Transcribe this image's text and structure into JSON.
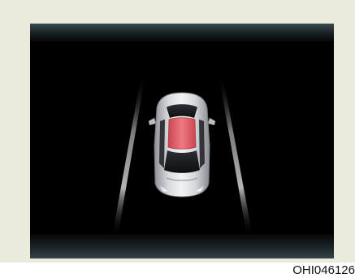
{
  "figure": {
    "caption": "OHI046126",
    "frame_color": "#ebebdc",
    "screen_color": "#000000"
  },
  "display": {
    "icon": "vehicle-top-view-icon",
    "highlight": "sunroof",
    "highlight_color": "#e8606a",
    "vehicle_color": "#c9cbcf",
    "lane_line_color": "#bfbfbf"
  }
}
